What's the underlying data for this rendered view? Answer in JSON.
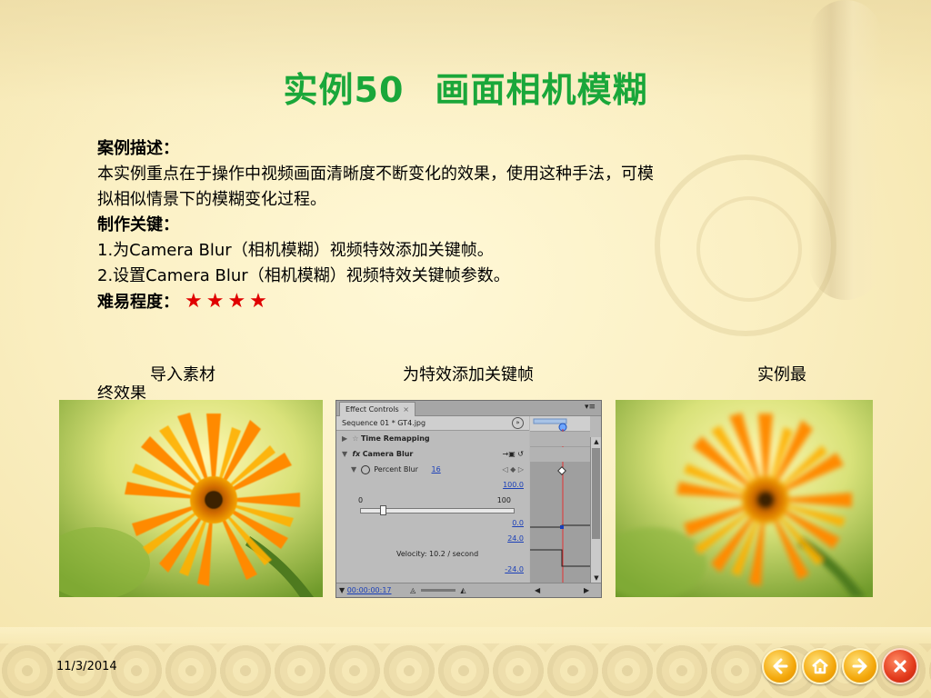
{
  "slide": {
    "title_number_part": "实例50",
    "title_text_part": "画面相机模糊",
    "section_desc_heading": "案例描述：",
    "section_desc_line1": "本实例重点在于操作中视频画面清晰度不断变化的效果，使用这种手法，可模",
    "section_desc_line2": "拟相似情景下的模糊变化过程。",
    "section_keys_heading": "制作关键：",
    "section_keys_item1": "1.为Camera Blur（相机模糊）视频特效添加关键帧。",
    "section_keys_item2": "2.设置Camera Blur（相机模糊）视频特效关键帧参数。",
    "difficulty_label": "难易程度：",
    "difficulty_stars": "★★★★",
    "difficulty_count": 4
  },
  "captions": {
    "import": "导入素材",
    "keyframe": "为特效添加关键帧",
    "final_a": "实例最",
    "final_b": "终效果"
  },
  "effect_controls": {
    "tab_label": "Effect Controls",
    "tab_close": "×",
    "sequence": "Sequence 01 * GT4.jpg",
    "time_remapping": "Time Remapping",
    "camera_blur": "Camera Blur",
    "percent_blur_label": "Percent Blur",
    "percent_blur_value": "16",
    "val_100": "100.0",
    "slider_min": "0",
    "slider_max": "100",
    "val_0": "0.0",
    "val_24": "24.0",
    "velocity": "Velocity: 10.2 / second",
    "val_neg24": "-24.0",
    "timecode": "00:00:00:17"
  },
  "footer": {
    "date": "11/3/2014"
  },
  "nav": {
    "prev_icon": "arrow-left-icon",
    "home_icon": "home-icon",
    "next_icon": "arrow-right-icon",
    "close_icon": "close-icon"
  },
  "colors": {
    "title": "#1aa73a",
    "stars": "#e00000",
    "nav_yellow": "#f4a80b",
    "nav_red": "#e2391b",
    "keyframe_line": "#e33333"
  }
}
